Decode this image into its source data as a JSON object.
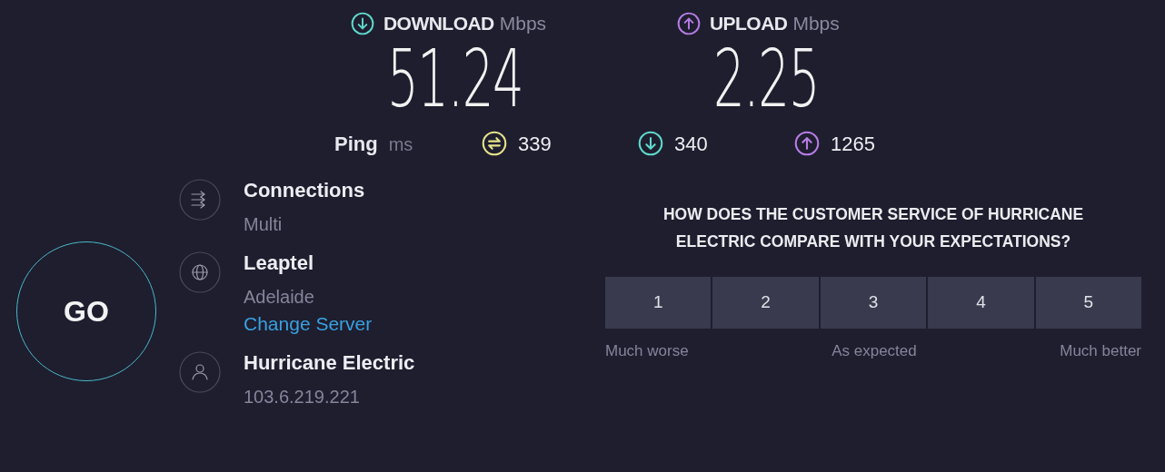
{
  "download": {
    "label": "DOWNLOAD",
    "unit": "Mbps",
    "value": "51.24"
  },
  "upload": {
    "label": "UPLOAD",
    "unit": "Mbps",
    "value": "2.25"
  },
  "ping": {
    "label": "Ping",
    "unit": "ms",
    "values": [
      {
        "kind": "idle",
        "value": "339"
      },
      {
        "kind": "download",
        "value": "340"
      },
      {
        "kind": "upload",
        "value": "1265"
      }
    ]
  },
  "go_button": "GO",
  "info": [
    {
      "kind": "connections",
      "title": "Connections",
      "subtitle": "Multi"
    },
    {
      "kind": "server",
      "title": "Leaptel",
      "subtitle": "Adelaide",
      "link": "Change Server"
    },
    {
      "kind": "provider",
      "title": "Hurricane Electric",
      "subtitle": "103.6.219.221"
    }
  ],
  "survey": {
    "question": "HOW DOES THE CUSTOMER SERVICE OF HURRICANE ELECTRIC COMPARE WITH YOUR EXPECTATIONS?",
    "options": [
      "1",
      "2",
      "3",
      "4",
      "5"
    ],
    "scale_labels": [
      "Much worse",
      "As expected",
      "Much better"
    ]
  }
}
